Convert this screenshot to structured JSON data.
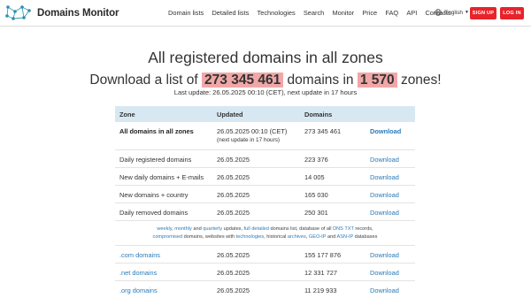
{
  "brand": {
    "name": "Domains Monitor"
  },
  "nav": [
    "Domain lists",
    "Detailed lists",
    "Technologies",
    "Search",
    "Monitor",
    "Price",
    "FAQ",
    "API",
    "Contacts"
  ],
  "language": {
    "label": "English"
  },
  "auth": {
    "signup": "SIGN UP",
    "login": "LOG IN"
  },
  "hero": {
    "title": "All registered domains in all zones",
    "download_prefix": "Download a list of",
    "domains_count": "273 345 461",
    "domains_word": "domains in",
    "zones_count": "1 570",
    "zones_word": "zones!",
    "last_update": "Last update: 26.05.2025 00:10 (CET), next update in 17 hours"
  },
  "table": {
    "headers": {
      "zone": "Zone",
      "updated": "Updated",
      "domains": "Domains"
    },
    "all": {
      "zone": "All domains in all zones",
      "updated": "26.05.2025 00:10 (CET)",
      "next": "(next update in 17 hours)",
      "domains": "273 345 461",
      "action": "Download"
    },
    "rows": [
      {
        "zone": "Daily registered domains",
        "updated": "26.05.2025",
        "domains": "223 376",
        "action": "Download"
      },
      {
        "zone": "New daily domains + E-mails",
        "updated": "26.05.2025",
        "domains": "14 005",
        "action": "Download"
      },
      {
        "zone": "New domains + country",
        "updated": "26.05.2025",
        "domains": "165 030",
        "action": "Download"
      },
      {
        "zone": "Daily removed domains",
        "updated": "26.05.2025",
        "domains": "250 301",
        "action": "Download"
      }
    ],
    "info": {
      "weekly": "weekly",
      "monthly": "monthly",
      "and": "and",
      "quarterly": "quarterly",
      "updates": "updates,",
      "full_detailed": "full detailed",
      "t1": "domains list, database of all",
      "dns_txt": "DNS TXT",
      "t2": "records,",
      "compromised": "compromised",
      "t3": "domains, websites with",
      "technologies": "technologies",
      "t4": ", historical",
      "archives": "archives",
      "t5": ",",
      "geoip": "GEO-IP",
      "t6": "and",
      "asnip": "ASN-IP",
      "t7": "databases"
    },
    "zones": [
      {
        "zone": ".com domains",
        "updated": "26.05.2025",
        "domains": "155 177 876",
        "action": "Download"
      },
      {
        "zone": ".net domains",
        "updated": "26.05.2025",
        "domains": "12 331 727",
        "action": "Download"
      },
      {
        "zone": ".org domains",
        "updated": "26.05.2025",
        "domains": "11 219 933",
        "action": "Download"
      }
    ]
  }
}
